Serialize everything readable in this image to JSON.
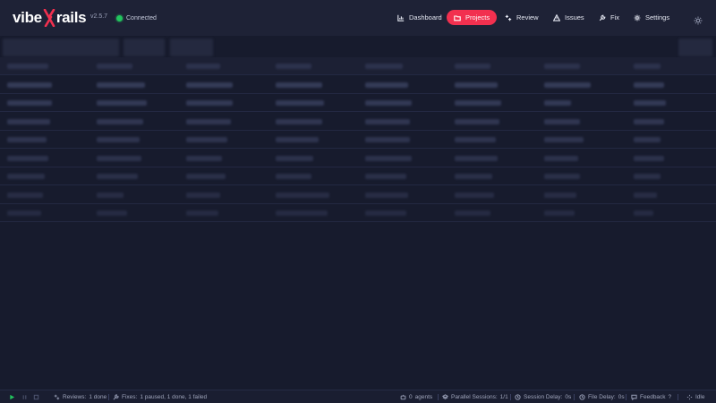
{
  "header": {
    "logo_left": "vibe",
    "logo_right": "rails",
    "version": "v2.5.7",
    "connection_status": "Connected",
    "connection_color": "#22c55e",
    "nav": [
      {
        "id": "dashboard",
        "label": "Dashboard",
        "icon": "bar-chart-icon",
        "active": false
      },
      {
        "id": "projects",
        "label": "Projects",
        "icon": "folder-icon",
        "active": true
      },
      {
        "id": "review",
        "label": "Review",
        "icon": "sparkles-icon",
        "active": false
      },
      {
        "id": "issues",
        "label": "Issues",
        "icon": "warning-triangle-icon",
        "active": false
      },
      {
        "id": "fix",
        "label": "Fix",
        "icon": "wrench-icon",
        "active": false
      },
      {
        "id": "settings",
        "label": "Settings",
        "icon": "gear-icon",
        "active": false
      }
    ],
    "theme_icon": "sun-icon"
  },
  "colors": {
    "accent": "#f2304f",
    "background": "#171b2d",
    "header": "#1e2236",
    "success": "#22c55e"
  },
  "statusbar": {
    "reviews_label": "Reviews:",
    "reviews_value": "1 done",
    "fixes_label": "Fixes:",
    "fixes_value": "1 paused, 1 done, 1 failed",
    "agents_count": "0",
    "agents_label": "agents",
    "parallel_label": "Parallel Sessions:",
    "parallel_value": "1/1",
    "session_delay_label": "Session Delay:",
    "session_delay_value": "0s",
    "file_delay_label": "File Delay:",
    "file_delay_value": "0s",
    "feedback_label": "Feedback",
    "feedback_mark": "?",
    "state": "Idle"
  }
}
